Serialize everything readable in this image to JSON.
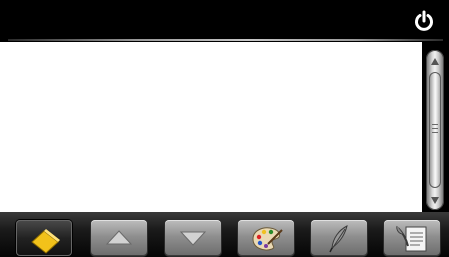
{
  "topbar": {
    "power_icon": "power-icon"
  },
  "content": {
    "text": ""
  },
  "scrollbar": {
    "up_icon": "arrow-up-icon",
    "down_icon": "arrow-down-icon"
  },
  "toolbar": {
    "buttons": [
      {
        "id": "eraser",
        "icon": "eraser-icon",
        "active": true
      },
      {
        "id": "scroll-up",
        "icon": "triangle-up-icon",
        "active": false
      },
      {
        "id": "scroll-down",
        "icon": "triangle-down-icon",
        "active": false
      },
      {
        "id": "palette",
        "icon": "palette-icon",
        "active": false
      },
      {
        "id": "pen",
        "icon": "feather-pen-icon",
        "active": false
      },
      {
        "id": "notes",
        "icon": "notepad-icon",
        "active": false
      }
    ]
  },
  "colors": {
    "topbar_bg": "#000000",
    "content_bg": "#ffffff",
    "eraser_yellow": "#f2c21a"
  }
}
